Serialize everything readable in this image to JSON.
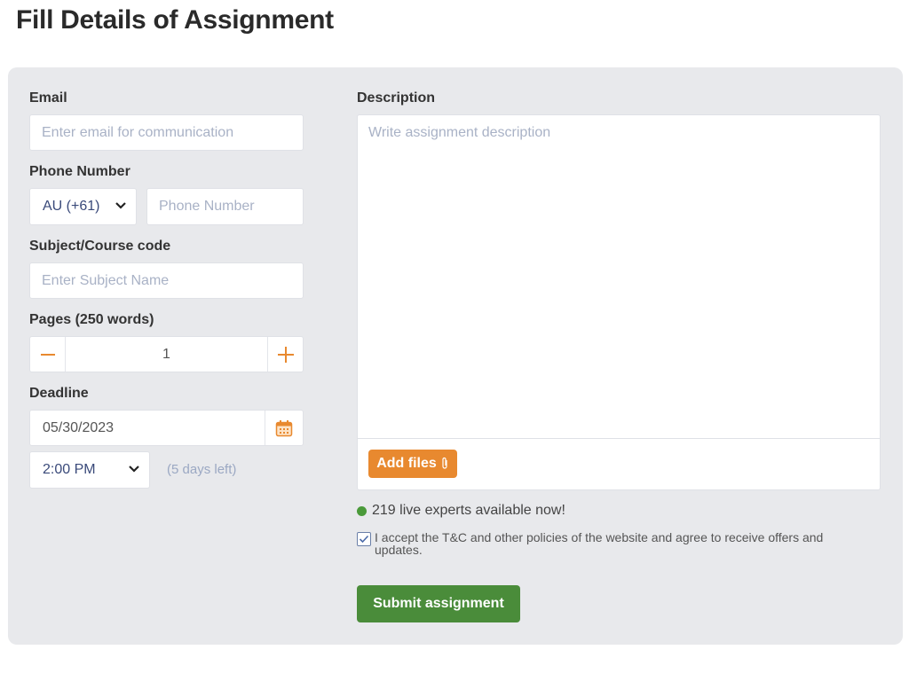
{
  "page": {
    "title": "Fill Details of Assignment"
  },
  "form": {
    "email": {
      "label": "Email",
      "placeholder": "Enter email for communication",
      "value": ""
    },
    "phone": {
      "label": "Phone Number",
      "country_code": "AU (+61)",
      "placeholder": "Phone Number",
      "value": ""
    },
    "subject": {
      "label": "Subject/Course code",
      "placeholder": "Enter Subject Name",
      "value": ""
    },
    "pages": {
      "label": "Pages (250 words)",
      "value": "1",
      "decrement_icon": "minus-icon",
      "increment_icon": "plus-icon"
    },
    "deadline": {
      "label": "Deadline",
      "date": "05/30/2023",
      "calendar_icon": "calendar-icon",
      "time": "2:00 PM",
      "days_left": "(5 days left)"
    },
    "description": {
      "label": "Description",
      "placeholder": "Write assignment description",
      "value": "",
      "add_files_label": "Add files",
      "attach_icon": "paperclip-icon"
    },
    "live_experts": "219 live experts available now!",
    "terms": {
      "checked": true,
      "text": "I accept the T&C and other policies of the website and agree to receive offers and updates."
    },
    "submit_label": "Submit assignment"
  },
  "colors": {
    "accent_orange": "#e8892f",
    "submit_green": "#4a8c3a",
    "live_dot_green": "#4a9a3a",
    "panel_bg": "#e8e9ec"
  }
}
